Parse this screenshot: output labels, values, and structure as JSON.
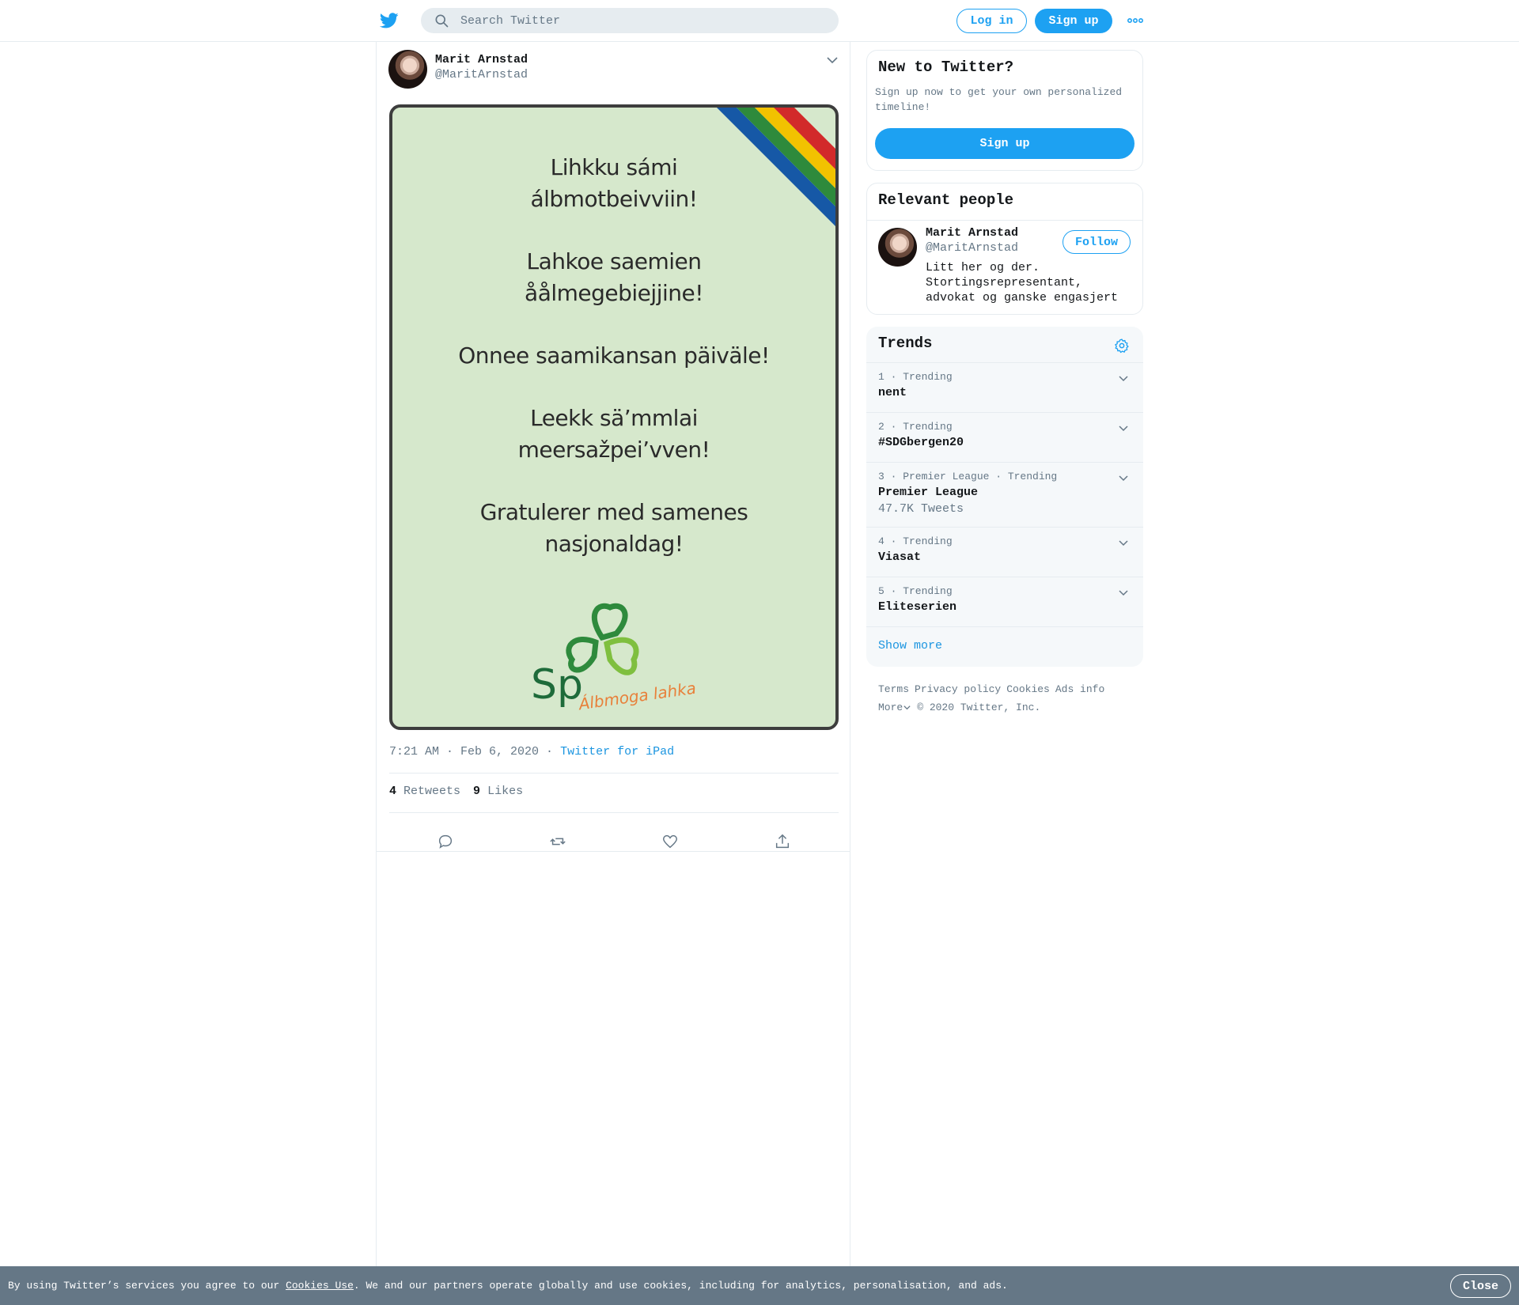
{
  "header": {
    "search_placeholder": "Search Twitter",
    "login_label": "Log in",
    "signup_label": "Sign up"
  },
  "tweet": {
    "author_name": "Marit Arnstad",
    "author_handle": "@MaritArnstad",
    "image_lines": [
      "Lihkku sámi",
      "álbmotbeivviin!",
      "Lahkoe saemien",
      "åålmegebiejjine!",
      "Onnee saamikansan päiväle!",
      "Leekk sä’mmlai",
      "meersažpei’vven!",
      "Gratulerer med samenes",
      "nasjonaldag!"
    ],
    "logo_text": "Sp",
    "logo_tagline": "Álbmoga lahka",
    "timestamp": "7:21 AM · Feb 6, 2020",
    "separator": "·",
    "source": "Twitter for iPad",
    "retweets_count": "4",
    "retweets_label": "Retweets",
    "likes_count": "9",
    "likes_label": "Likes"
  },
  "signup_card": {
    "title": "New to Twitter?",
    "description": "Sign up now to get your own personalized timeline!",
    "button_label": "Sign up"
  },
  "relevant_people": {
    "title": "Relevant people",
    "person": {
      "name": "Marit Arnstad",
      "handle": "@MaritArnstad",
      "bio": "Litt her og der. Stortingsrepresentant, advokat og ganske engasjert",
      "follow_label": "Follow"
    }
  },
  "trends": {
    "title": "Trends",
    "items": [
      {
        "meta": "1 · Trending",
        "name": "nent",
        "count": ""
      },
      {
        "meta": "2 · Trending",
        "name": "#SDGbergen20",
        "count": ""
      },
      {
        "meta": "3 · Premier League · Trending",
        "name": "Premier League",
        "count": "47.7K Tweets"
      },
      {
        "meta": "4 · Trending",
        "name": "Viasat",
        "count": ""
      },
      {
        "meta": "5 · Trending",
        "name": "Eliteserien",
        "count": ""
      }
    ],
    "show_more": "Show more"
  },
  "footer": {
    "links": [
      "Terms",
      "Privacy policy",
      "Cookies",
      "Ads info"
    ],
    "more": "More",
    "copyright": "© 2020 Twitter, Inc."
  },
  "cookie_bar": {
    "text_before": "By using Twitter’s services you agree to our ",
    "link": "Cookies Use",
    "text_after": ". We and our partners operate globally and use cookies, including for analytics, personalisation, and ads.",
    "close_label": "Close"
  },
  "colors": {
    "accent": "#1da1f2",
    "link": "#1b95e0",
    "muted": "#657786",
    "cookie_bar": "#657786",
    "image_background": "#d6e8cc"
  },
  "icons": [
    "twitter-bird-icon",
    "search-icon",
    "more-dots-icon",
    "chevron-down-icon",
    "reply-icon",
    "retweet-icon",
    "like-icon",
    "share-icon",
    "gear-icon"
  ]
}
